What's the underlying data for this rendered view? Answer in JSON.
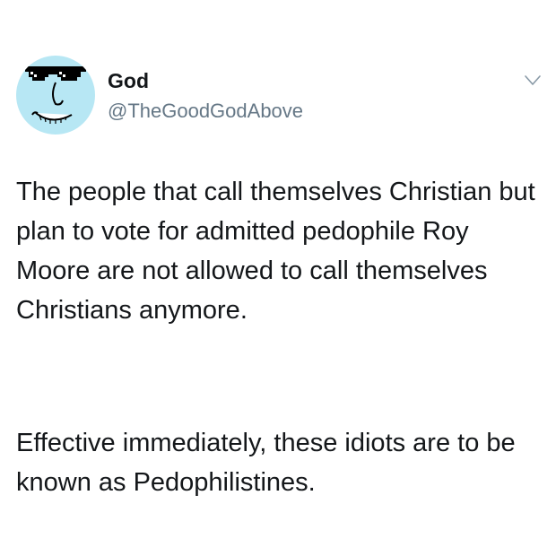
{
  "tweet": {
    "author": {
      "display_name": "God",
      "handle": "@TheGoodGodAbove",
      "avatar_icon": "cartoon-face-with-pixel-sunglasses-icon",
      "avatar_bg": "#b7e7f4"
    },
    "menu_icon": "chevron-down-icon",
    "paragraphs": [
      "The people that call themselves Christian but plan to vote for admitted pedophile Roy Moore are not allowed to call themselves Christians anymore.",
      "Effective immediately, these idiots are to be known as Pedophilistines."
    ]
  },
  "colors": {
    "text_primary": "#14171a",
    "text_secondary": "#657786"
  }
}
